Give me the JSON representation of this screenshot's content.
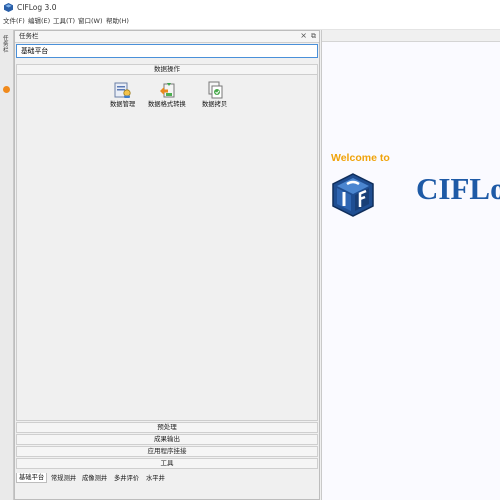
{
  "window": {
    "title": "CIFLog 3.0"
  },
  "menu": [
    "文件(F)",
    "编辑(E)",
    "工具(T)",
    "窗口(W)",
    "帮助(H)"
  ],
  "side_strip": {
    "tab_label": "任务栏"
  },
  "task_panel": {
    "title": "任务栏",
    "close_glyph": "×",
    "float_glyph": "⧉",
    "platform_selected": "基础平台",
    "sections": {
      "data_ops": "数据操作",
      "preprocess": "预处理",
      "output": "成果输出",
      "plugins": "应用程序挂接",
      "tools": "工具"
    },
    "tools": [
      {
        "label": "数据管理",
        "icon": "data-management-icon"
      },
      {
        "label": "数据格式转换",
        "icon": "format-conversion-icon"
      },
      {
        "label": "数据拷贝",
        "icon": "data-copy-icon"
      }
    ],
    "bottom_tabs": [
      "基础平台",
      "常规测井",
      "成像测井",
      "多井评价",
      "水平井"
    ],
    "active_tab": "基础平台"
  },
  "welcome": {
    "welcome_text": "Welcome to",
    "product_name": "CIFLo"
  },
  "colors": {
    "accent_blue": "#1e5aa6",
    "welcome_orange": "#f0a30a",
    "combo_border": "#4a90d9"
  }
}
